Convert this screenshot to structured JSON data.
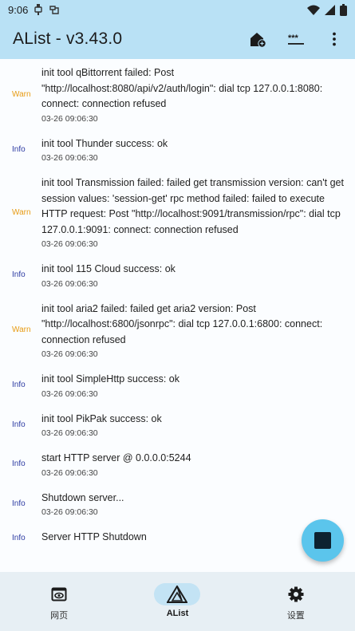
{
  "status_bar": {
    "time": "9:06"
  },
  "app_bar": {
    "title": "AList - v3.43.0"
  },
  "logs": [
    {
      "level": "Warn",
      "message": "init tool qBittorrent failed: Post \"http://localhost:8080/api/v2/auth/login\": dial tcp 127.0.0.1:8080: connect: connection refused",
      "time": "03-26 09:06:30"
    },
    {
      "level": "Info",
      "message": "init tool Thunder success: ok",
      "time": "03-26 09:06:30"
    },
    {
      "level": "Warn",
      "message": "init tool Transmission failed: failed get transmission version: can't get session values: 'session-get' rpc method failed: failed to execute HTTP request: Post \"http://localhost:9091/transmission/rpc\": dial tcp 127.0.0.1:9091: connect: connection refused",
      "time": "03-26 09:06:30"
    },
    {
      "level": "Info",
      "message": "init tool 115 Cloud success: ok",
      "time": "03-26 09:06:30"
    },
    {
      "level": "Warn",
      "message": "init tool aria2 failed: failed get aria2 version: Post \"http://localhost:6800/jsonrpc\": dial tcp 127.0.0.1:6800: connect: connection refused",
      "time": "03-26 09:06:30"
    },
    {
      "level": "Info",
      "message": "init tool SimpleHttp success: ok",
      "time": "03-26 09:06:30"
    },
    {
      "level": "Info",
      "message": "init tool PikPak success: ok",
      "time": "03-26 09:06:30"
    },
    {
      "level": "Info",
      "message": "start HTTP server @ 0.0.0.0:5244",
      "time": "03-26 09:06:30"
    },
    {
      "level": "Info",
      "message": "Shutdown server...",
      "time": "03-26 09:06:30"
    },
    {
      "level": "Info",
      "message": "Server HTTP Shutdown",
      "time": ""
    }
  ],
  "bottom_nav": {
    "items": [
      {
        "label": "网页",
        "icon": "web-view-icon",
        "active": false
      },
      {
        "label": "AList",
        "icon": "alist-logo-icon",
        "active": true
      },
      {
        "label": "设置",
        "icon": "gear-icon",
        "active": false
      }
    ]
  },
  "colors": {
    "app_bar": "#b9e1f5",
    "warn": "#e79b13",
    "info": "#2c3aa2",
    "fab": "#5bc5ec",
    "nav_bg": "#e7eff4"
  }
}
